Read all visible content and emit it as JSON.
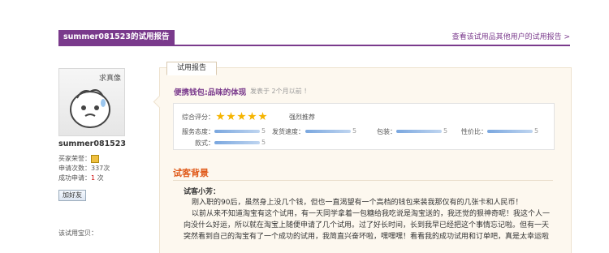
{
  "header": {
    "title": "summer081523的试用报告",
    "more_link": "查看该试用品其他用户的试用报告 >"
  },
  "user": {
    "avatar_badge": "求真像",
    "name": "summer081523",
    "honor_label": "买家荣誉：",
    "apply_count_label": "申请次数：",
    "apply_count_value": "337次",
    "success_label": "成功申请：",
    "success_value": "1",
    "success_unit": "次",
    "add_friend": "加好友",
    "trial_label": "该试用宝贝："
  },
  "report": {
    "tab_label": "试用报告",
    "product_title": "便携钱包:品味的体现",
    "posted": "发表于 2个月以前 ！",
    "overall_label": "综合评分：",
    "overall_stars": 5,
    "recommend": "强烈推荐",
    "metrics_row1": [
      {
        "label": "服务态度：",
        "score": "5"
      },
      {
        "label": "发货速度：",
        "score": "5"
      },
      {
        "label": "包装：",
        "score": "5"
      },
      {
        "label": "性价比：",
        "score": "5"
      }
    ],
    "metrics_row2": [
      {
        "label": "款式：",
        "score": "5"
      }
    ],
    "section_title": "试客背景",
    "nickname": "试客小芳：",
    "paragraphs": [
      "刚入职的90后，虽然身上没几个钱，但也一直渴望有一个高档的钱包来装我那仅有的几张卡和人民币！",
      "以前从来不知道淘宝有这个试用，有一天同学拿着一包糖给我吃说是淘宝送的，我还觉的狠神奇呢！我这个人一",
      "向没什么好运，所以就在淘宝上随便申请了几个试用。过了好长时间，长到我早已经把这个事情忘记啦。但有一天",
      "突然看到自己的淘宝有了一个成功的试用，我简直兴奋坏啦，嘿嘿嘿！看看我的成功试用和订单吧，真是太幸运啦"
    ]
  },
  "colors": {
    "accent": "#7a3a8c",
    "section": "#e05a1a",
    "star": "#f5b400"
  }
}
